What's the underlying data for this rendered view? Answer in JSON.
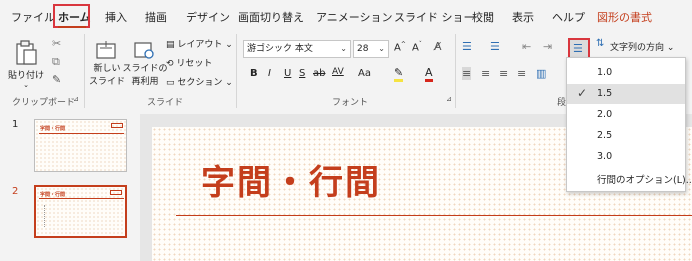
{
  "tabs": [
    "ファイル",
    "ホーム",
    "挿入",
    "描画",
    "デザイン",
    "画面切り替え",
    "アニメーション",
    "スライド ショー",
    "校閲",
    "表示",
    "ヘルプ",
    "図形の書式"
  ],
  "clipboard": {
    "paste": "貼り付け",
    "group": "クリップボード"
  },
  "slides_group": {
    "new_slide": "新しい\nスライド",
    "new_slide_l1": "新しい",
    "new_slide_l2": "スライド",
    "reuse_l1": "スライドの",
    "reuse_l2": "再利用",
    "layout": "レイアウト",
    "reset": "リセット",
    "section": "セクション",
    "group": "スライド"
  },
  "font_group": {
    "font_name": "游ゴシック 本文",
    "font_size": "28",
    "bold": "B",
    "italic": "I",
    "underline": "U",
    "shadow": "S",
    "strike": "ab",
    "spacing": "AV",
    "case": "Aa",
    "group": "フォント"
  },
  "paragraph": {
    "text_direction": "文字列の方向",
    "group": "段"
  },
  "line_spacing": {
    "options": [
      "1.0",
      "1.5",
      "2.0",
      "2.5",
      "3.0"
    ],
    "selected": "1.5",
    "more": "行間のオプション(L)..."
  },
  "thumbnails": [
    {
      "num": "1",
      "title": "字間・行間"
    },
    {
      "num": "2",
      "title": "字間・行間"
    }
  ],
  "slide": {
    "title": "字間・行間"
  },
  "colors": {
    "accent": "#c43e1c",
    "highlight_box": "#d9363e"
  }
}
